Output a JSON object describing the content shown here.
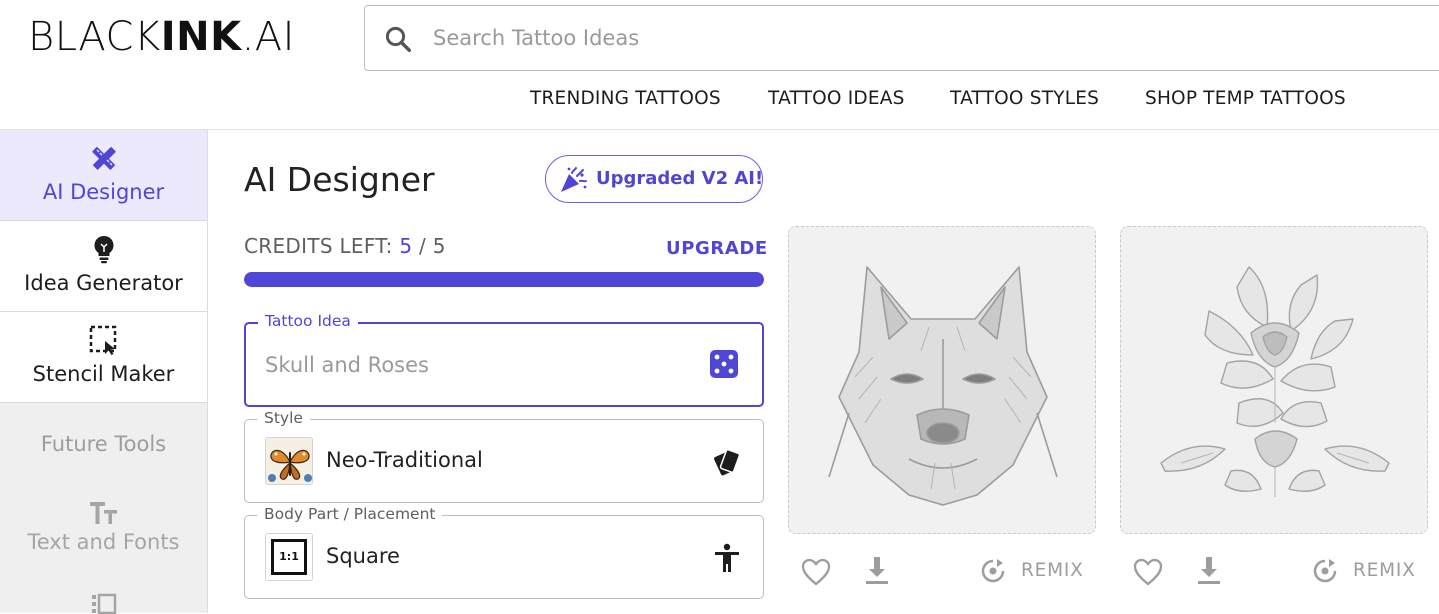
{
  "header": {
    "logo_part1": "BLACK",
    "logo_part2": "INK",
    "logo_part3": ".AI",
    "search": {
      "placeholder": "Search Tattoo Ideas",
      "value": ""
    },
    "nav": [
      "TRENDING TATTOOS",
      "TATTOO IDEAS",
      "TATTOO STYLES",
      "SHOP TEMP TATTOOS"
    ]
  },
  "sidebar": {
    "items": [
      {
        "label": "AI Designer",
        "icon": "pencil-ruler-icon",
        "active": true
      },
      {
        "label": "Idea Generator",
        "icon": "lightbulb-icon",
        "active": false
      },
      {
        "label": "Stencil Maker",
        "icon": "stencil-icon",
        "active": false
      }
    ],
    "future_heading": "Future Tools",
    "future_items": [
      {
        "label": "Text and Fonts",
        "icon": "text-fonts-icon"
      },
      {
        "label": "",
        "icon": "layout-icon"
      }
    ]
  },
  "main": {
    "title": "AI Designer",
    "upgrade_pill": "Upgraded V2 AI!",
    "credits": {
      "label": "CREDITS LEFT:",
      "remaining": "5",
      "separator": "/",
      "total": "5",
      "fraction": 1.0
    },
    "upgrade_link": "UPGRADE",
    "tattoo_idea": {
      "legend": "Tattoo Idea",
      "placeholder": "Skull and Roses",
      "value": ""
    },
    "style": {
      "legend": "Style",
      "value": "Neo-Traditional"
    },
    "placement": {
      "legend": "Body Part / Placement",
      "value": "Square",
      "badge": "1:1"
    }
  },
  "gallery": [
    {
      "subject": "wolf-tattoo",
      "remix_label": "REMIX"
    },
    {
      "subject": "flower-tattoo",
      "remix_label": "REMIX"
    }
  ],
  "colors": {
    "accent": "#5046d6",
    "accent_light": "#ebe9fb",
    "muted": "#9d9d9d"
  }
}
